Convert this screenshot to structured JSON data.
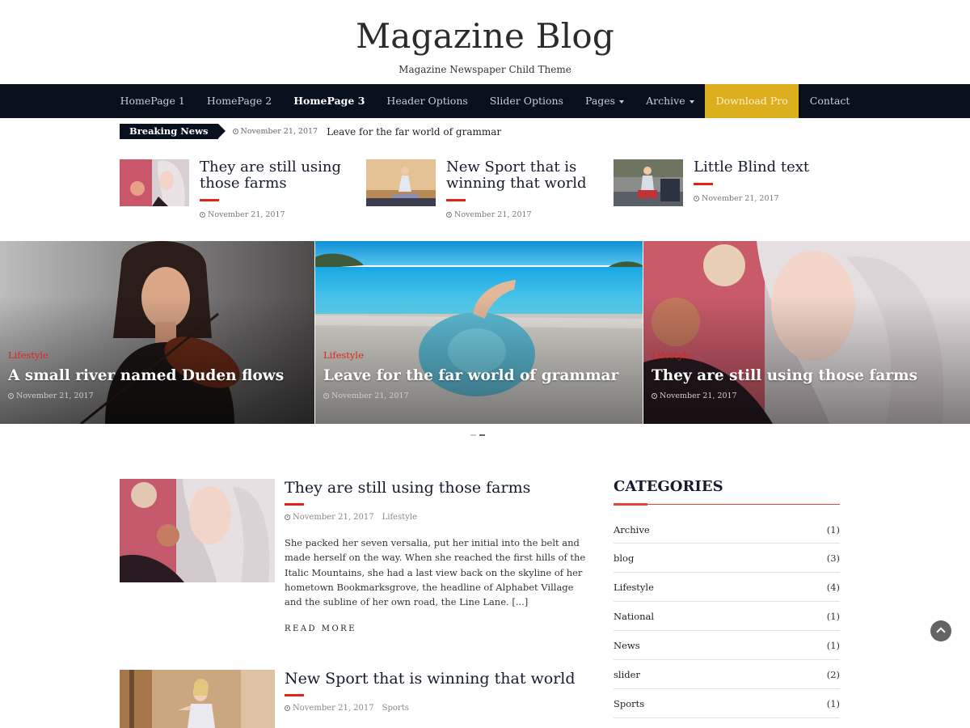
{
  "site": {
    "title": "Magazine Blog",
    "tagline": "Magazine Newspaper Child Theme"
  },
  "nav": {
    "items": [
      {
        "label": "HomePage 1"
      },
      {
        "label": "HomePage 2"
      },
      {
        "label": "HomePage 3"
      },
      {
        "label": "Header Options"
      },
      {
        "label": "Slider Options"
      },
      {
        "label": "Pages"
      },
      {
        "label": "Archive"
      },
      {
        "label": "Download Pro"
      },
      {
        "label": "Contact"
      }
    ],
    "active": "HomePage 3",
    "pro_color": "#dcae1d"
  },
  "breaking": {
    "label": "Breaking News",
    "date": "November 21, 2017",
    "headline": "Leave for the far world of grammar"
  },
  "featured": [
    {
      "title": "They are still using those farms",
      "date": "November 21, 2017"
    },
    {
      "title": "New Sport that is winning that world",
      "date": "November 21, 2017"
    },
    {
      "title": "Little Blind text",
      "date": "November 21, 2017"
    }
  ],
  "slider": {
    "slides": [
      {
        "category": "Lifestyle",
        "title": "A small river named Duden flows",
        "date": "November 21, 2017"
      },
      {
        "category": "Lifestyle",
        "title": "Leave for the far world of grammar",
        "date": "November 21, 2017"
      },
      {
        "category": "Lifestyle",
        "title": "They are still using those farms",
        "date": "November 21, 2017"
      }
    ]
  },
  "posts": [
    {
      "title": "They are still using those farms",
      "date": "November 21, 2017",
      "category": "Lifestyle",
      "excerpt": "She packed her seven versalia, put her initial into the belt and made herself on the way. When she reached the first hills of the Italic Mountains, she had a last view back on the skyline of her hometown Bookmarksgrove, the headline of Alphabet Village and the subline of her own road, the Line Lane. [...]",
      "read_more": "READ MORE"
    },
    {
      "title": "New Sport that is winning that world",
      "date": "November 21, 2017",
      "category": "Sports"
    }
  ],
  "sidebar": {
    "title": "CATEGORIES",
    "categories": [
      {
        "name": "Archive",
        "count": "(1)"
      },
      {
        "name": "blog",
        "count": "(3)"
      },
      {
        "name": "Lifestyle",
        "count": "(4)"
      },
      {
        "name": "National",
        "count": "(1)"
      },
      {
        "name": "News",
        "count": "(1)"
      },
      {
        "name": "slider",
        "count": "(2)"
      },
      {
        "name": "Sports",
        "count": "(1)"
      }
    ]
  },
  "colors": {
    "nav_bg": "#08101e",
    "accent_red": "#e2231a",
    "accent_gold": "#dcae1d"
  }
}
